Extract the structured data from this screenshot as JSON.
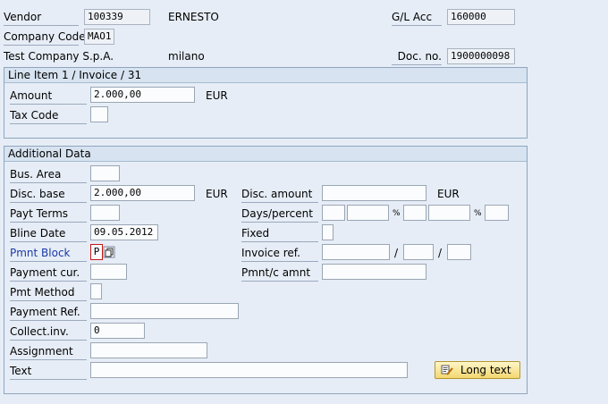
{
  "header": {
    "vendor_label": "Vendor",
    "vendor_value": "100339",
    "vendor_name": "ERNESTO",
    "gl_acc_label": "G/L Acc",
    "gl_acc_value": "160000",
    "company_code_label": "Company Code",
    "company_code_value": "MAO1",
    "company_name": "Test Company S.p.A.",
    "city": "milano",
    "doc_no_label": "Doc. no.",
    "doc_no_value": "1900000098"
  },
  "line_item": {
    "title": "Line Item 1 / Invoice / 31",
    "amount_label": "Amount",
    "amount_value": "2.000,00",
    "amount_currency": "EUR",
    "tax_code_label": "Tax Code",
    "tax_code_value": ""
  },
  "additional": {
    "title": "Additional Data",
    "bus_area_label": "Bus. Area",
    "bus_area_value": "",
    "disc_base_label": "Disc. base",
    "disc_base_value": "2.000,00",
    "disc_base_currency": "EUR",
    "disc_amount_label": "Disc. amount",
    "disc_amount_value": "",
    "disc_amount_currency": "EUR",
    "payt_terms_label": "Payt Terms",
    "payt_terms_value": "",
    "days_percent_label": "Days/percent",
    "percent_sign": "%",
    "bline_date_label": "Bline Date",
    "bline_date_value": "09.05.2012",
    "fixed_label": "Fixed",
    "pmnt_block_label": "Pmnt Block",
    "pmnt_block_value": "P",
    "invoice_ref_label": "Invoice ref.",
    "slash": "/",
    "payment_cur_label": "Payment cur.",
    "payment_cur_value": "",
    "pmnt_c_amnt_label": "Pmnt/c amnt",
    "pmnt_c_amnt_value": "",
    "pmt_method_label": "Pmt Method",
    "pmt_method_value": "",
    "payment_ref_label": "Payment Ref.",
    "payment_ref_value": "",
    "collect_inv_label": "Collect.inv.",
    "collect_inv_value": "0",
    "assignment_label": "Assignment",
    "assignment_value": "",
    "text_label": "Text",
    "text_value": "",
    "long_text_button": "Long text"
  },
  "icons": {
    "long_text_icon": "document-pencil-icon",
    "possible_entries_icon": "possible-entries-icon"
  },
  "colors": {
    "background": "#e6edf6",
    "link_label": "#1b3aa6",
    "required_highlight": "#c51a1a",
    "button_yellow": "#f3d770"
  }
}
